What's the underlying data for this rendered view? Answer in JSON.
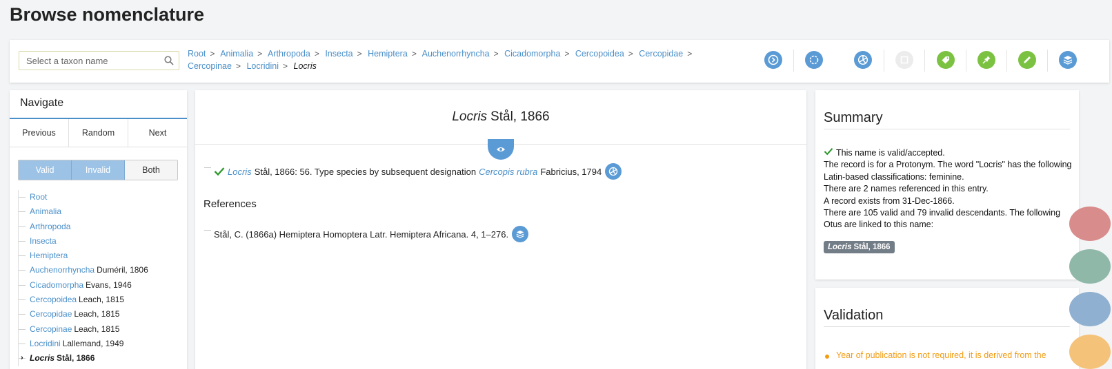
{
  "page_title": "Browse nomenclature",
  "search": {
    "placeholder": "Select a taxon name"
  },
  "breadcrumbs": [
    "Root",
    "Animalia",
    "Arthropoda",
    "Insecta",
    "Hemiptera",
    "Auchenorrhyncha",
    "Cicadomorpha",
    "Cercopoidea",
    "Cercopidae",
    "Cercopinae",
    "Locridini"
  ],
  "breadcrumb_current": "Locris",
  "toolbar_icons": [
    "radial-navigator-icon",
    "radial-annotator-icon",
    "radial-object-icon",
    "disabled-icon",
    "tag-icon",
    "pin-icon",
    "pencil-icon",
    "layers-icon"
  ],
  "toolbar_colors": {
    "blue": "#5b9bd5",
    "green": "#7cc242",
    "disabled": "#e6e6e6"
  },
  "navigate": {
    "title": "Navigate",
    "buttons": {
      "previous": "Previous",
      "random": "Random",
      "next": "Next"
    },
    "filters": {
      "valid": "Valid",
      "invalid": "Invalid",
      "both": "Both"
    },
    "tree": [
      {
        "name": "Root",
        "author": ""
      },
      {
        "name": "Animalia",
        "author": ""
      },
      {
        "name": "Arthropoda",
        "author": ""
      },
      {
        "name": "Insecta",
        "author": ""
      },
      {
        "name": "Hemiptera",
        "author": ""
      },
      {
        "name": "Auchenorrhyncha",
        "author": "Duméril, 1806"
      },
      {
        "name": "Cicadomorpha",
        "author": "Evans, 1946"
      },
      {
        "name": "Cercopoidea",
        "author": "Leach, 1815"
      },
      {
        "name": "Cercopidae",
        "author": "Leach, 1815"
      },
      {
        "name": "Cercopinae",
        "author": "Leach, 1815"
      },
      {
        "name": "Locridini",
        "author": "Lallemand, 1949"
      }
    ],
    "tree_current": {
      "name": "Locris",
      "author": "Stål, 1866"
    }
  },
  "main": {
    "title_genus": "Locris",
    "title_author": "Stål, 1866",
    "record": {
      "genus": "Locris",
      "text": "Stål, 1866: 56. Type species by subsequent designation",
      "type_species": "Cercopis rubra",
      "type_author": "Fabricius, 1794"
    },
    "references_title": "References",
    "reference": "Stål, C. (1866a) Hemiptera Homoptera Latr. Hemiptera Africana. 4, 1–276."
  },
  "summary": {
    "title": "Summary",
    "lines": [
      "This name is valid/accepted.",
      "The record is for a Protonym. The word \"Locris\" has the following Latin-based classifications: feminine.",
      "There are 2 names referenced in this entry.",
      "A record exists from 31-Dec-1866.",
      "There are 105 valid and 79 invalid descendants. The following Otus are linked to this name:"
    ],
    "otu": {
      "genus": "Locris",
      "author": "Stål, 1866"
    }
  },
  "validation": {
    "title": "Validation",
    "message": "Year of publication is not required, it is derived from the"
  },
  "colors": {
    "link": "#4a8fc9",
    "accent": "#5b9bd5",
    "valid_check": "#2e9a2e",
    "warning": "#f39c12"
  }
}
